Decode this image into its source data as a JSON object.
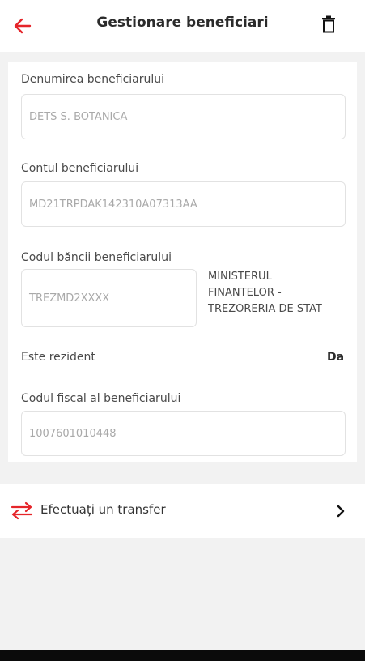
{
  "header": {
    "title": "Gestionare beneficiari",
    "back_icon": "arrow-left-icon",
    "delete_icon": "trash-icon",
    "accent_color": "#e5252a"
  },
  "form": {
    "name_label": "Denumirea beneficiarului",
    "name_value": "DETS S. BOTANICA",
    "account_label": "Contul beneficiarului",
    "account_value": "MD21TRPDAK142310A07313AA",
    "bank_code_label": "Codul băncii beneficiarului",
    "bank_code_value": "TREZMD2XXXX",
    "bank_name_lines": [
      "MINISTERUL",
      "FINANTELOR -",
      "TREZORERIA DE STAT"
    ],
    "resident_label": "Este rezident",
    "resident_value": "Da",
    "fiscal_code_label": "Codul fiscal al beneficiarului",
    "fiscal_code_value": "1007601010448"
  },
  "transfer": {
    "label": "Efectuați un transfer",
    "icon": "transfer-arrows-icon",
    "chevron_icon": "chevron-right-icon"
  }
}
